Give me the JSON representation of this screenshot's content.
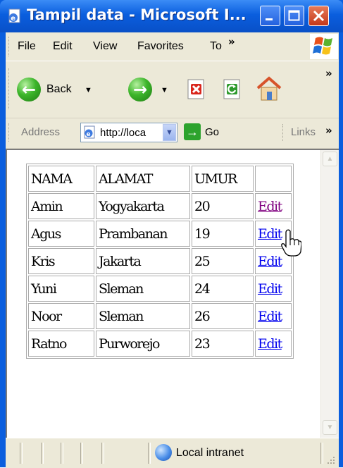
{
  "window": {
    "title": "Tampil data - Microsoft I...",
    "buttons": {
      "minimize": "minimize-icon",
      "maximize": "maximize-icon",
      "close": "close-icon"
    }
  },
  "menubar": {
    "items": [
      "File",
      "Edit",
      "View",
      "Favorites",
      "To"
    ],
    "overflow": "»"
  },
  "toolbar": {
    "back_label": "Back",
    "overflow": "»"
  },
  "addressbar": {
    "label": "Address",
    "url": "http://loca",
    "go_label": "Go",
    "links_label": "Links",
    "overflow": "»"
  },
  "table": {
    "headers": [
      "NAMA",
      "ALAMAT",
      "UMUR",
      ""
    ],
    "rows": [
      {
        "nama": "Amin",
        "alamat": "Yogyakarta",
        "umur": "20",
        "action": "Edit",
        "visited": true
      },
      {
        "nama": "Agus",
        "alamat": "Prambanan",
        "umur": "19",
        "action": "Edit",
        "visited": false
      },
      {
        "nama": "Kris",
        "alamat": "Jakarta",
        "umur": "25",
        "action": "Edit",
        "visited": false
      },
      {
        "nama": "Yuni",
        "alamat": "Sleman",
        "umur": "24",
        "action": "Edit",
        "visited": false
      },
      {
        "nama": "Noor",
        "alamat": "Sleman",
        "umur": "26",
        "action": "Edit",
        "visited": false
      },
      {
        "nama": "Ratno",
        "alamat": "Purworejo",
        "umur": "23",
        "action": "Edit",
        "visited": false
      }
    ]
  },
  "statusbar": {
    "zone": "Local intranet"
  },
  "colors": {
    "titlebar": "#0a5ede",
    "link": "#0000ee",
    "visited_link": "#800080",
    "chrome": "#ece9d8"
  }
}
